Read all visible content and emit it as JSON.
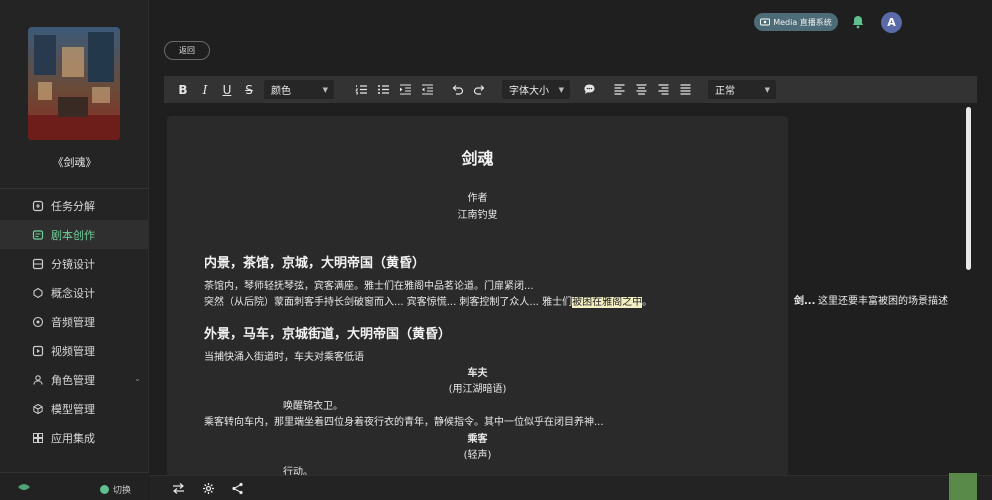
{
  "sidebar": {
    "work_title": "《剑魂》",
    "items": [
      {
        "label": "任务分解",
        "icon": "task-icon",
        "active": false
      },
      {
        "label": "剧本创作",
        "icon": "script-icon",
        "active": true
      },
      {
        "label": "分镜设计",
        "icon": "storyboard-icon",
        "active": false
      },
      {
        "label": "概念设计",
        "icon": "concept-icon",
        "active": false
      },
      {
        "label": "音频管理",
        "icon": "audio-icon",
        "active": false
      },
      {
        "label": "视频管理",
        "icon": "video-icon",
        "active": false
      },
      {
        "label": "角色管理",
        "icon": "character-icon",
        "active": false
      },
      {
        "label": "模型管理",
        "icon": "model-icon",
        "active": false
      },
      {
        "label": "应用集成",
        "icon": "apps-icon",
        "active": false
      }
    ],
    "switch_label": "切换"
  },
  "header": {
    "media_label": "Media 直播系统",
    "avatar_letter": "A",
    "back_label": "返回"
  },
  "toolbar": {
    "color_label": "颜色",
    "font_size_label": "字体大小",
    "paragraph_label": "正常"
  },
  "document": {
    "title": "剑魂",
    "author_label": "作者",
    "author": "江南钓叟",
    "scene1_heading": "内景，茶馆，京城，大明帝国（黄昏）",
    "scene1_line1": "茶馆内，琴师轻抚琴弦，宾客满座。雅士们在雅阁中品茗论道。门扉紧闭...",
    "scene1_line2_a": "突然（从后院）蒙面刺客手持长剑破窗而入... 宾客惊慌... 刺客控制了众人... 雅士们",
    "scene1_line2_hl": "被困在雅阁之中",
    "scene1_line2_b": "。",
    "scene2_heading": "外景，马车，京城街道，大明帝国（黄昏）",
    "scene2_line1": "当捕快涌入街道时，车夫对乘客低语",
    "char1": "车夫",
    "paren1": "(用江湖暗语)",
    "dialog1": "唤醒锦衣卫。",
    "scene2_line2": "乘客转向车内，那里端坐着四位身着夜行衣的青年，静候指令。其中一位似乎在闭目养神...",
    "char2": "乘客",
    "paren2": "(轻声)",
    "dialog2": "行动。"
  },
  "comment": {
    "anchor": "剑...",
    "text": "这里还要丰富被困的场景描述"
  },
  "colors": {
    "accent": "#6fcf97",
    "highlight": "#f3efc2",
    "media_pill": "#4e6c78"
  }
}
